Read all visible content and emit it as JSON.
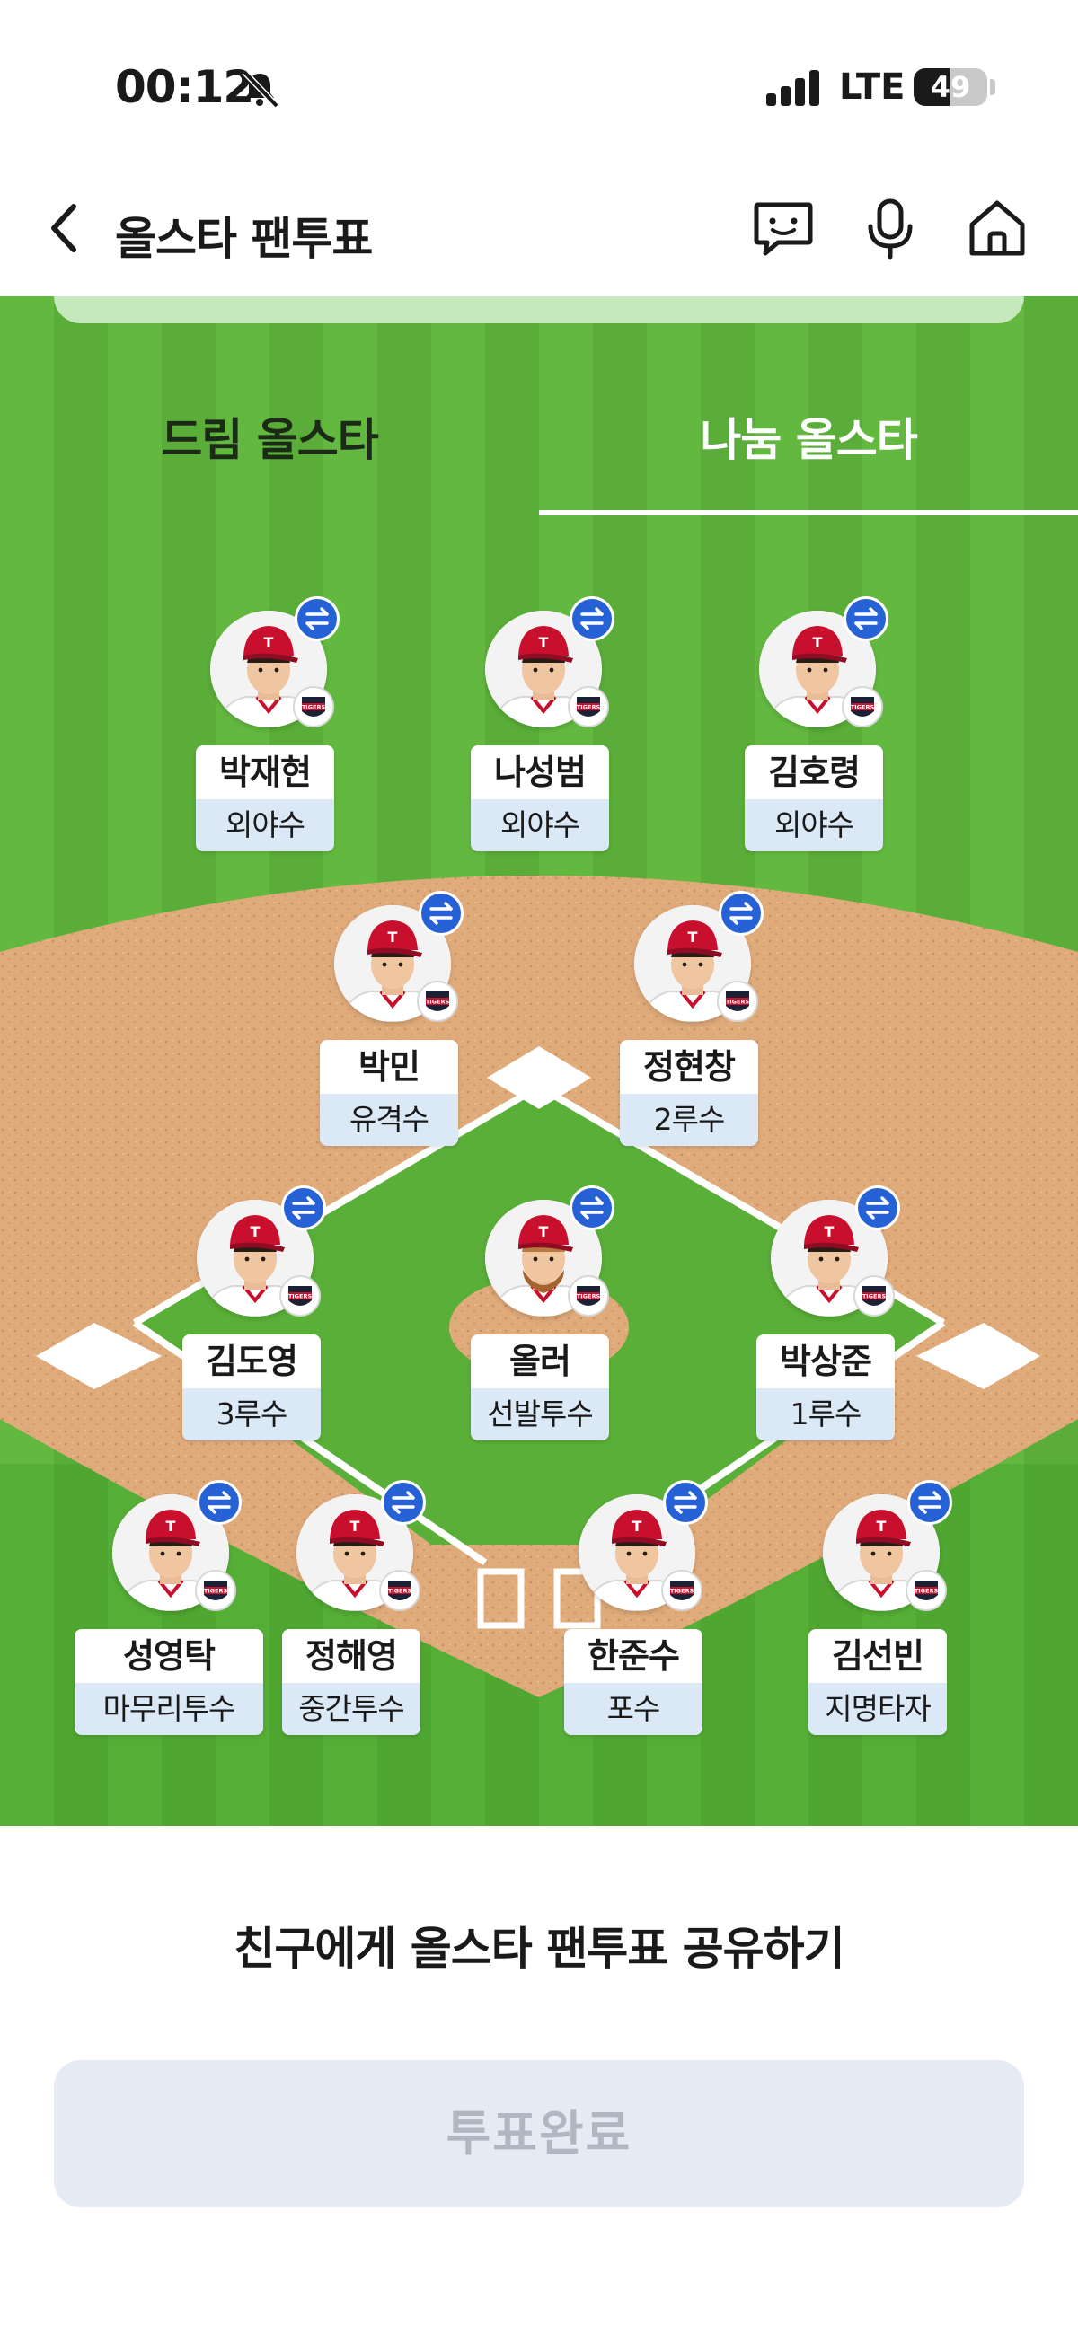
{
  "status_bar": {
    "time": "00:12",
    "network": "LTE",
    "battery": "49",
    "battery_level": 0.49,
    "icons": [
      "bell-mute-icon",
      "signal-bars-icon",
      "battery-icon"
    ]
  },
  "nav": {
    "title": "올스타 팬투표",
    "icons": [
      "back-chevron-icon",
      "chatbot-icon",
      "microphone-icon",
      "home-icon"
    ]
  },
  "tabs": [
    {
      "label": "드림 올스타",
      "selected": false
    },
    {
      "label": "나눔 올스타",
      "selected": true
    }
  ],
  "team_logo_text": "TIGERS",
  "colors": {
    "field_green": "#5fb53d",
    "infield_dirt": "#e0ab7b",
    "swap_badge": "#2761d6",
    "position_bg": "#dbe8f5",
    "button_bg": "#e6eaf2",
    "button_text": "#b1b7c2"
  },
  "players": [
    {
      "name": "박재현",
      "position": "외야수",
      "hair": "dark",
      "beard": false
    },
    {
      "name": "나성범",
      "position": "외야수",
      "hair": "dark",
      "beard": false
    },
    {
      "name": "김호령",
      "position": "외야수",
      "hair": "dark",
      "beard": false
    },
    {
      "name": "박민",
      "position": "유격수",
      "hair": "dark",
      "beard": false
    },
    {
      "name": "정현창",
      "position": "2루수",
      "hair": "dark",
      "beard": false
    },
    {
      "name": "김도영",
      "position": "3루수",
      "hair": "dark",
      "beard": false
    },
    {
      "name": "올러",
      "position": "선발투수",
      "hair": "light",
      "beard": true
    },
    {
      "name": "박상준",
      "position": "1루수",
      "hair": "dark",
      "beard": false
    },
    {
      "name": "성영탁",
      "position": "마무리투수",
      "hair": "dark",
      "beard": false
    },
    {
      "name": "정해영",
      "position": "중간투수",
      "hair": "dark",
      "beard": false
    },
    {
      "name": "한준수",
      "position": "포수",
      "hair": "dark",
      "beard": false
    },
    {
      "name": "김선빈",
      "position": "지명타자",
      "hair": "dark",
      "beard": false
    }
  ],
  "share_label": "친구에게 올스타 팬투표 공유하기",
  "vote_button_label": "투표완료"
}
